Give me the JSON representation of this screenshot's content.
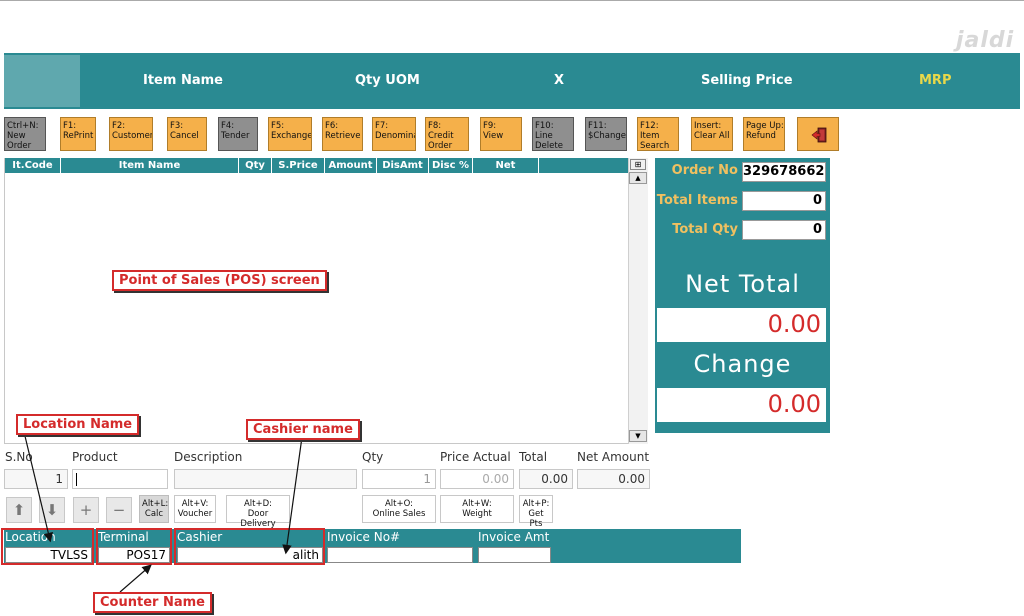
{
  "watermark": "jaldi",
  "header": {
    "columns": [
      {
        "label": "Item Name"
      },
      {
        "label": "Qty UOM"
      },
      {
        "label": "X"
      },
      {
        "label": "Selling Price"
      },
      {
        "label": "MRP"
      }
    ]
  },
  "toolbar": {
    "buttons": [
      {
        "lines": [
          "Ctrl+N:",
          "New",
          "Order"
        ],
        "state": "gray"
      },
      {
        "lines": [
          "F1:",
          "RePrint"
        ],
        "state": "orange"
      },
      {
        "lines": [
          "F2:",
          "Customer"
        ],
        "state": "orange"
      },
      {
        "lines": [
          "F3:",
          "Cancel"
        ],
        "state": "orange"
      },
      {
        "lines": [
          "F4:",
          "Tender"
        ],
        "state": "gray"
      },
      {
        "lines": [
          "F5:",
          "Exchange"
        ],
        "state": "orange"
      },
      {
        "lines": [
          "F6:",
          "Retrieve"
        ],
        "state": "orange"
      },
      {
        "lines": [
          "F7:",
          "Denomina"
        ],
        "state": "orange"
      },
      {
        "lines": [
          "F8:",
          "Credit",
          "Order"
        ],
        "state": "orange"
      },
      {
        "lines": [
          "F9:",
          "View"
        ],
        "state": "orange"
      },
      {
        "lines": [
          "F10:",
          "Line",
          "Delete"
        ],
        "state": "gray"
      },
      {
        "lines": [
          "F11:",
          "$Change"
        ],
        "state": "gray"
      },
      {
        "lines": [
          "F12:",
          "Item",
          "Search"
        ],
        "state": "orange"
      },
      {
        "lines": [
          "Insert:",
          "Clear All"
        ],
        "state": "orange"
      },
      {
        "lines": [
          "Page Up:",
          "Refund"
        ],
        "state": "orange"
      }
    ],
    "exit_icon": "exit-door-icon"
  },
  "grid": {
    "columns": [
      "It.Code",
      "Item Name",
      "Qty",
      "S.Price",
      "Amount",
      "DisAmt",
      "Disc %",
      "Net Amount"
    ]
  },
  "annotations": {
    "pos_screen": "Point of Sales (POS) screen",
    "location_name": "Location Name",
    "cashier_name": "Cashier name",
    "counter_name": "Counter Name"
  },
  "summary": {
    "order_no_label": "Order No",
    "order_no_value": "329678662",
    "total_items_label": "Total Items",
    "total_items_value": "0",
    "total_qty_label": "Total Qty",
    "total_qty_value": "0",
    "net_total_label": "Net Total",
    "net_total_value": "0.00",
    "change_label": "Change",
    "change_value": "0.00"
  },
  "entry": {
    "sno_label": "S.No",
    "sno_value": "1",
    "product_label": "Product",
    "product_value": "",
    "description_label": "Description",
    "qty_label": "Qty",
    "qty_value": "1",
    "price_actual_label": "Price Actual",
    "price_actual_value": "0.00",
    "total_label": "Total",
    "total_value": "0.00",
    "net_amount_label": "Net Amount",
    "net_amount_value": "0.00"
  },
  "actions": {
    "calc": [
      "Alt+L:",
      "Calc"
    ],
    "voucher": [
      "Alt+V:",
      "Voucher"
    ],
    "door_delivery": [
      "Alt+D:",
      "Door Delivery"
    ],
    "online_sales": [
      "Alt+O:",
      "Online Sales"
    ],
    "weight": [
      "Alt+W:",
      "Weight"
    ],
    "get_pts": [
      "Alt+P:",
      "Get Pts"
    ]
  },
  "status": {
    "location_label": "Location",
    "location_value": "TVLSS",
    "terminal_label": "Terminal",
    "terminal_value": "POS17",
    "cashier_label": "Cashier",
    "cashier_value": "alith",
    "invoice_no_label": "Invoice No#",
    "invoice_no_value": "",
    "invoice_amt_label": "Invoice Amt",
    "invoice_amt_value": ""
  },
  "colors": {
    "teal": "#2a8a92",
    "orange_button": "#f5b04a",
    "gray_button": "#8f8f8f",
    "mrp": "#e8d84a",
    "summary_label": "#f0c060",
    "annotation_red": "#d42b2b"
  }
}
